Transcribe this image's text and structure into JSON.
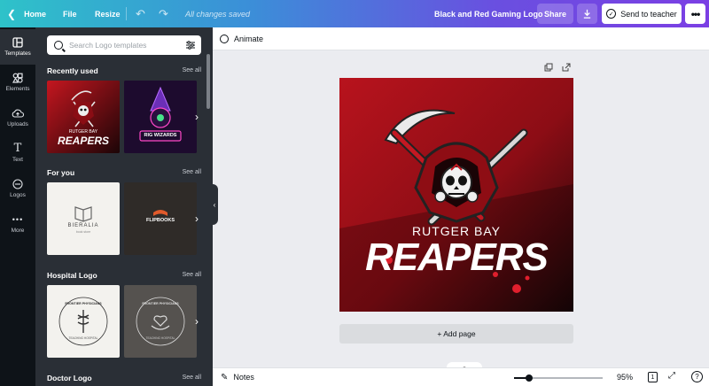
{
  "topbar": {
    "home_label": "Home",
    "file_label": "File",
    "resize_label": "Resize",
    "save_status": "All changes saved",
    "design_title": "Black and Red Gaming Logo",
    "share_label": "Share",
    "send_label": "Send to teacher",
    "more_icon": "ellipsis-icon"
  },
  "rail": {
    "items": [
      {
        "label": "Templates",
        "icon": "templates-icon"
      },
      {
        "label": "Elements",
        "icon": "elements-icon"
      },
      {
        "label": "Uploads",
        "icon": "upload-icon"
      },
      {
        "label": "Text",
        "icon": "text-icon"
      },
      {
        "label": "Logos",
        "icon": "logos-icon"
      },
      {
        "label": "More",
        "icon": "more-icon"
      }
    ]
  },
  "panel": {
    "search_placeholder": "Search Logo templates",
    "see_all": "See all",
    "sections": [
      {
        "title": "Recently used",
        "thumbs": [
          {
            "line1": "RUTGER BAY",
            "line2": "REAPERS"
          },
          {
            "line1": "RIG WIZARDS",
            "line2": ""
          }
        ]
      },
      {
        "title": "For you",
        "thumbs": [
          {
            "line1": "BIERALIA",
            "line2": "book store"
          },
          {
            "line1": "FLIPBOOKS",
            "line2": ""
          }
        ]
      },
      {
        "title": "Hospital Logo",
        "thumbs": [
          {
            "line1": "FRONTIER PHYSICIANS",
            "line2": "TEACHING HOSPITAL"
          },
          {
            "line1": "FRONTIER PHYSICIANS",
            "line2": "TEACHING HOSPITAL"
          }
        ]
      },
      {
        "title": "Doctor Logo",
        "thumbs": []
      }
    ]
  },
  "animate_label": "Animate",
  "design": {
    "line1": "RUTGER BAY",
    "line2": "REAPERS",
    "colors": {
      "primary": "#b0121e",
      "dark": "#1a0608",
      "accent": "#e01f2d"
    }
  },
  "add_page_label": "+ Add page",
  "bottombar": {
    "notes_label": "Notes",
    "zoom_label": "95%",
    "zoom_fraction": 0.17,
    "page_count": "1"
  }
}
